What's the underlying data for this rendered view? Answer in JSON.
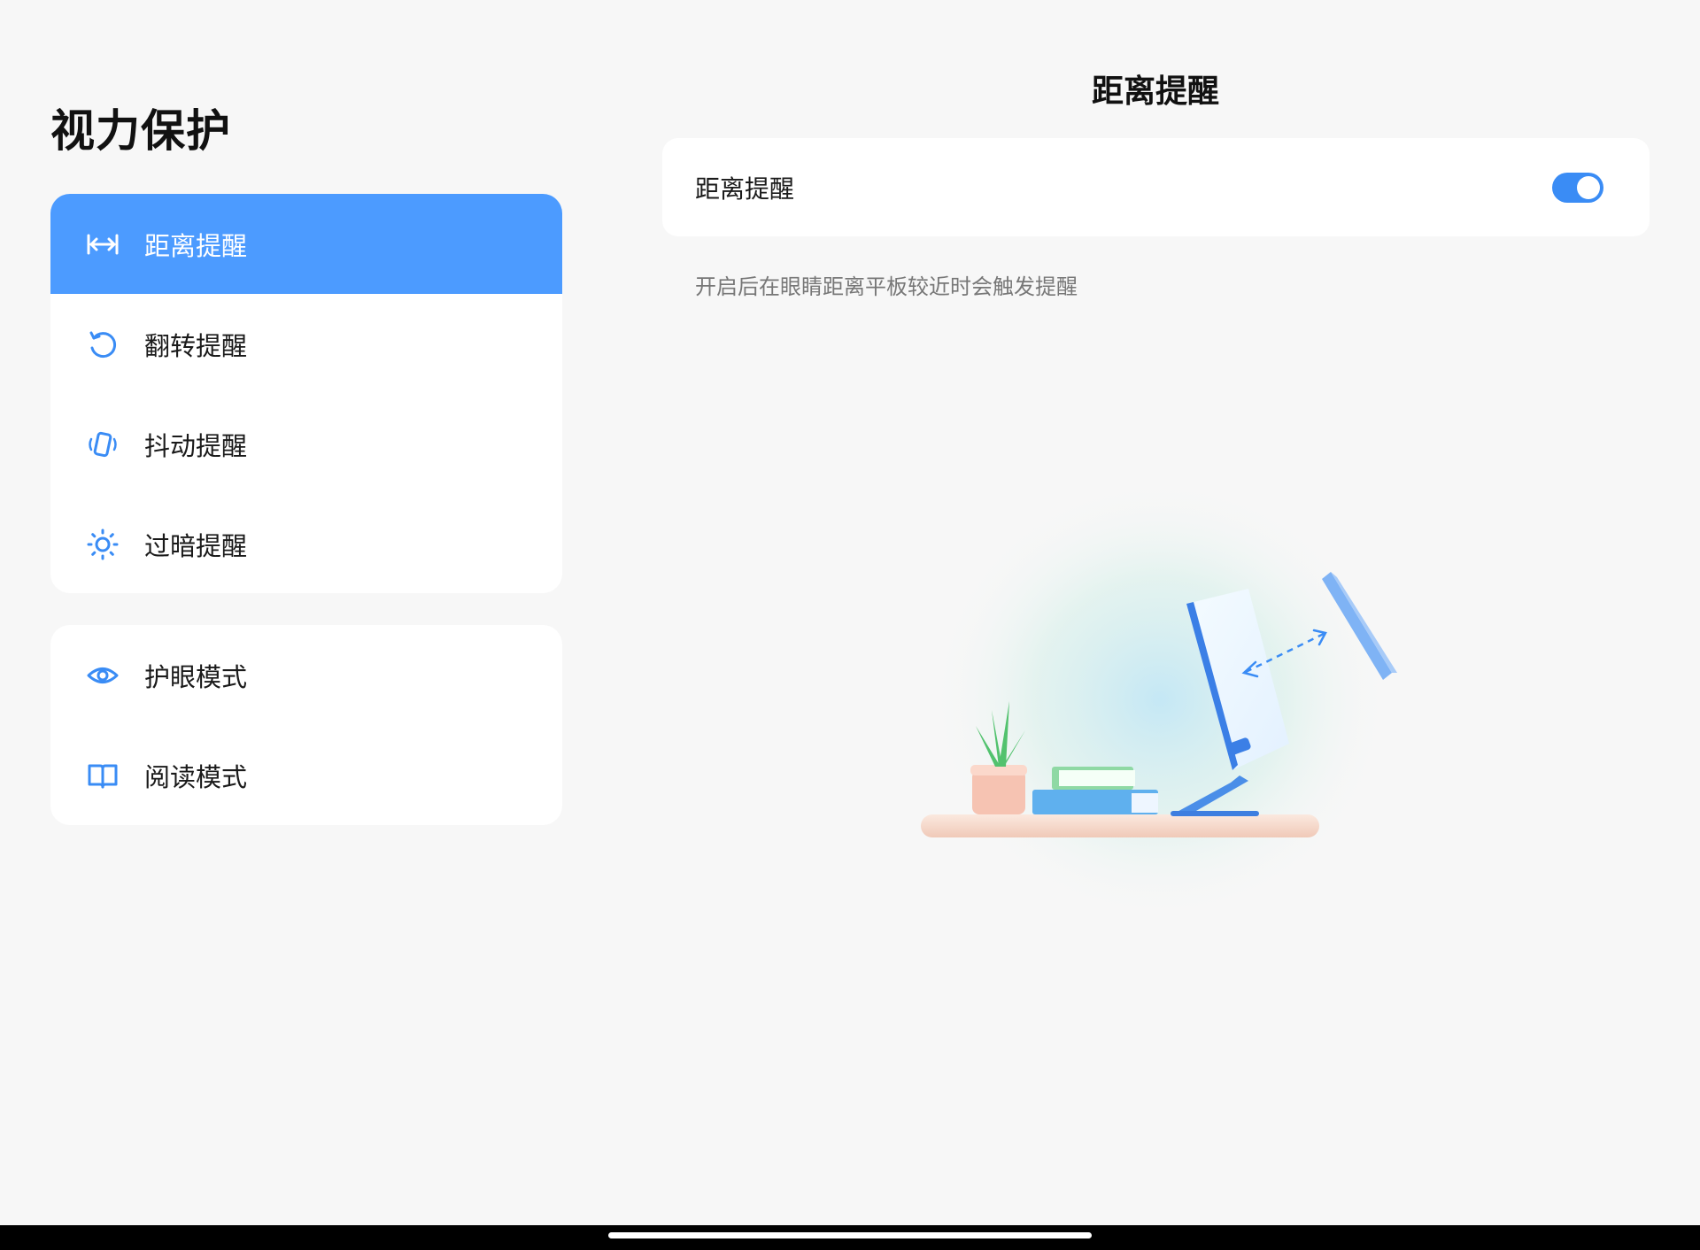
{
  "left_panel": {
    "title": "视力保护",
    "group1": [
      {
        "label": "距离提醒",
        "icon": "distance-icon",
        "active": true
      },
      {
        "label": "翻转提醒",
        "icon": "rotate-icon",
        "active": false
      },
      {
        "label": "抖动提醒",
        "icon": "vibrate-icon",
        "active": false
      },
      {
        "label": "过暗提醒",
        "icon": "brightness-icon",
        "active": false
      }
    ],
    "group2": [
      {
        "label": "护眼模式",
        "icon": "eye-icon"
      },
      {
        "label": "阅读模式",
        "icon": "book-icon"
      }
    ]
  },
  "right_panel": {
    "title": "距离提醒",
    "setting_label": "距离提醒",
    "toggle_on": true,
    "description": "开启后在眼睛距离平板较近时会触发提醒"
  },
  "colors": {
    "accent": "#4c9bff",
    "toggle": "#3a8cf5",
    "background": "#f7f7f7",
    "icon": "#3a8cf5"
  }
}
